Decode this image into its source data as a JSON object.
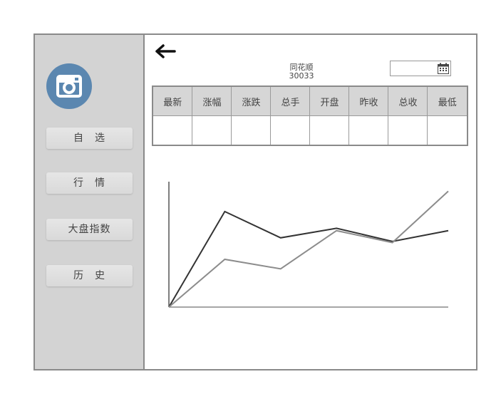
{
  "sidebar": {
    "avatar_icon": "camera-icon",
    "items": [
      {
        "label": "自　选"
      },
      {
        "label": "行　情"
      },
      {
        "label": "大盘指数"
      },
      {
        "label": "历　史"
      }
    ]
  },
  "header": {
    "back_icon": "arrow-left-icon",
    "title": "同花顺",
    "code": "30033",
    "date_value": "",
    "calendar_icon": "calendar-icon"
  },
  "quote_table": {
    "columns": [
      "最新",
      "涨幅",
      "涨跌",
      "总手",
      "开盘",
      "昨收",
      "总收",
      "最低"
    ],
    "rows": [
      [
        "",
        "",
        "",
        "",
        "",
        "",
        "",
        ""
      ]
    ]
  },
  "chart_data": {
    "type": "line",
    "x": [
      0,
      1,
      2,
      3,
      4,
      5
    ],
    "series": [
      {
        "values": [
          0,
          80,
          58,
          66,
          55,
          64
        ],
        "color": "#333333"
      },
      {
        "values": [
          0,
          40,
          32,
          64,
          54,
          97
        ],
        "color": "#8c8c8c"
      }
    ],
    "ylim": [
      0,
      105
    ],
    "title": "",
    "xlabel": "",
    "ylabel": ""
  }
}
